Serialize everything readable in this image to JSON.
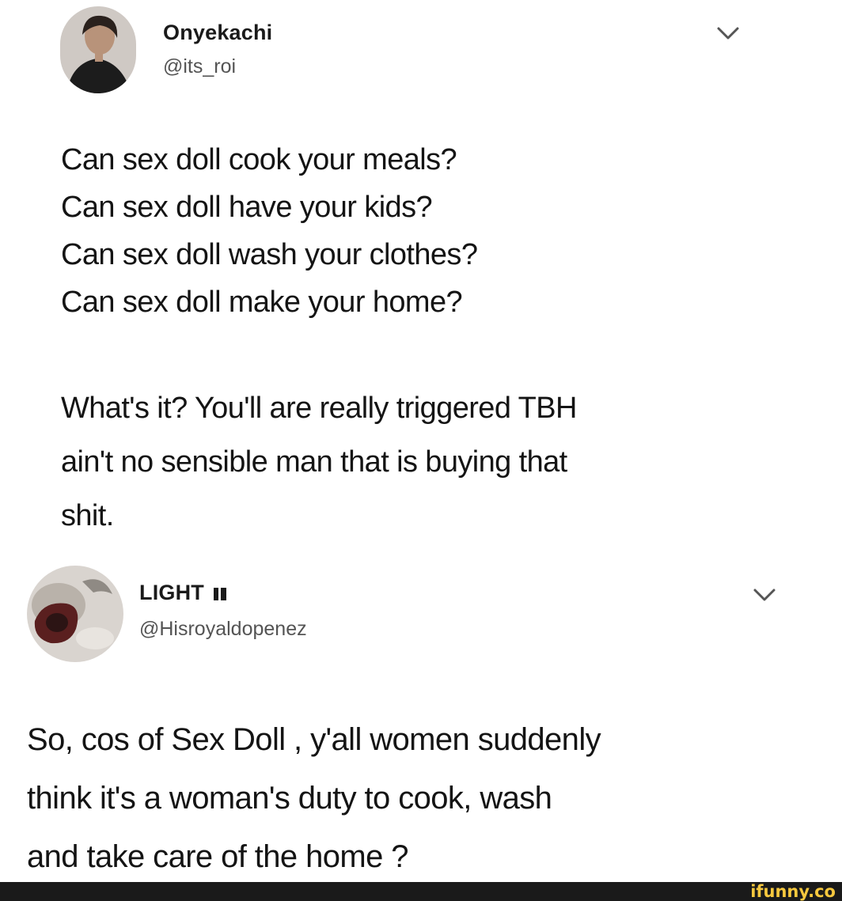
{
  "tweets": [
    {
      "author_name": "Onyekachi",
      "handle": "@its_roi",
      "lines": [
        "Can sex doll cook your meals?",
        "Can sex doll have your kids?",
        "Can sex doll wash your clothes?",
        "Can sex doll make your home?"
      ],
      "paragraph2": [
        "What's it? You'll are really triggered TBH",
        "ain't no sensible man that is buying that",
        "shit."
      ]
    },
    {
      "author_name": "LIGHT",
      "handle": "@Hisroyaldopenez",
      "lines": [
        "So, cos of Sex Doll , y'all women suddenly",
        "think it's a woman's duty to cook, wash",
        "and take care of the home ?"
      ]
    }
  ],
  "watermark": "ifunny.co",
  "colors": {
    "background": "#ffffff",
    "text": "#141414",
    "handle": "#545454",
    "footer": "#1a1a1a",
    "watermark": "#f6c83e"
  },
  "icons": [
    "avatar-onyekachi",
    "chevron-down-icon",
    "avatar-light",
    "flag-icon"
  ]
}
